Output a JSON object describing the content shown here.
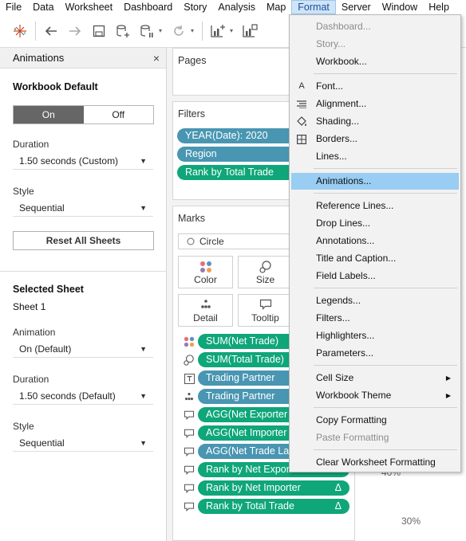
{
  "menubar": {
    "items": [
      "File",
      "Data",
      "Worksheet",
      "Dashboard",
      "Story",
      "Analysis",
      "Map",
      "Format",
      "Server",
      "Window",
      "Help"
    ],
    "active_index": 7
  },
  "toolbar": {
    "icons": [
      "tableau-logo-icon",
      "undo-icon",
      "redo-icon",
      "save-icon",
      "new-datasource-icon",
      "pause-updates-icon",
      "refresh-icon",
      "new-worksheet-icon",
      "duplicate-icon"
    ]
  },
  "animations_pane": {
    "title": "Animations",
    "close_glyph": "×",
    "workbook_default_title": "Workbook Default",
    "toggle_on": "On",
    "toggle_off": "Off",
    "duration_label": "Duration",
    "duration_value": "1.50 seconds (Custom)",
    "style_label": "Style",
    "style_value": "Sequential",
    "reset_button": "Reset All Sheets",
    "selected_sheet_title": "Selected Sheet",
    "sheet_name": "Sheet 1",
    "animation_label": "Animation",
    "animation_value": "On (Default)",
    "sheet_duration_label": "Duration",
    "sheet_duration_value": "1.50 seconds (Default)",
    "sheet_style_label": "Style",
    "sheet_style_value": "Sequential"
  },
  "pages_card": {
    "title": "Pages"
  },
  "filters_card": {
    "title": "Filters",
    "pills": [
      {
        "label": "YEAR(Date): 2020",
        "color": "blue"
      },
      {
        "label": "Region",
        "color": "blue"
      },
      {
        "label": "Rank by Total Trade",
        "color": "green"
      }
    ]
  },
  "marks_card": {
    "title": "Marks",
    "mark_type": "Circle",
    "buttons": [
      "Color",
      "Size",
      "Detail",
      "Tooltip"
    ],
    "fields": [
      {
        "label": "SUM(Net Trade)",
        "color": "green",
        "icon": "color-dots-icon"
      },
      {
        "label": "SUM(Total Trade)",
        "color": "green",
        "icon": "size-icon"
      },
      {
        "label": "Trading Partner",
        "color": "blue",
        "icon": "label-icon"
      },
      {
        "label": "Trading Partner",
        "color": "blue",
        "icon": "detail-icon"
      },
      {
        "label": "AGG(Net Exporter",
        "color": "green",
        "icon": "tooltip-icon"
      },
      {
        "label": "AGG(Net Importer",
        "color": "green",
        "icon": "tooltip-icon"
      },
      {
        "label": "AGG(Net Trade La",
        "color": "blue",
        "icon": "tooltip-icon"
      },
      {
        "label": "Rank by Net Expor",
        "color": "green",
        "icon": "tooltip-icon",
        "delta": ""
      },
      {
        "label": "Rank by Net Importer",
        "color": "green",
        "icon": "tooltip-icon",
        "delta": "Δ"
      },
      {
        "label": "Rank by Total Trade",
        "color": "green",
        "icon": "tooltip-icon",
        "delta": "Δ"
      }
    ]
  },
  "format_menu": {
    "items": [
      {
        "label": "Dashboard...",
        "disabled": true
      },
      {
        "label": "Story...",
        "disabled": true
      },
      {
        "label": "Workbook..."
      },
      {
        "label": "Font...",
        "icon": "font-icon"
      },
      {
        "label": "Alignment...",
        "icon": "alignment-icon"
      },
      {
        "label": "Shading...",
        "icon": "shading-icon"
      },
      {
        "label": "Borders...",
        "icon": "borders-icon"
      },
      {
        "label": "Lines..."
      },
      {
        "label": "Animations...",
        "selected": true
      },
      {
        "label": "Reference Lines..."
      },
      {
        "label": "Drop Lines..."
      },
      {
        "label": "Annotations..."
      },
      {
        "label": "Title and Caption..."
      },
      {
        "label": "Field Labels..."
      },
      {
        "label": "Legends..."
      },
      {
        "label": "Filters..."
      },
      {
        "label": "Highlighters..."
      },
      {
        "label": "Parameters..."
      },
      {
        "label": "Cell Size",
        "submenu": true
      },
      {
        "label": "Workbook Theme",
        "submenu": true
      },
      {
        "label": "Copy Formatting"
      },
      {
        "label": "Paste Formatting",
        "disabled": true
      },
      {
        "label": "Clear Worksheet Formatting"
      }
    ]
  },
  "view": {
    "axis_ticks": [
      "40%",
      "30%"
    ]
  },
  "colors": {
    "pill_blue": "#4996b2",
    "pill_green": "#0fa67a",
    "menu_highlight": "#99cdf3"
  }
}
